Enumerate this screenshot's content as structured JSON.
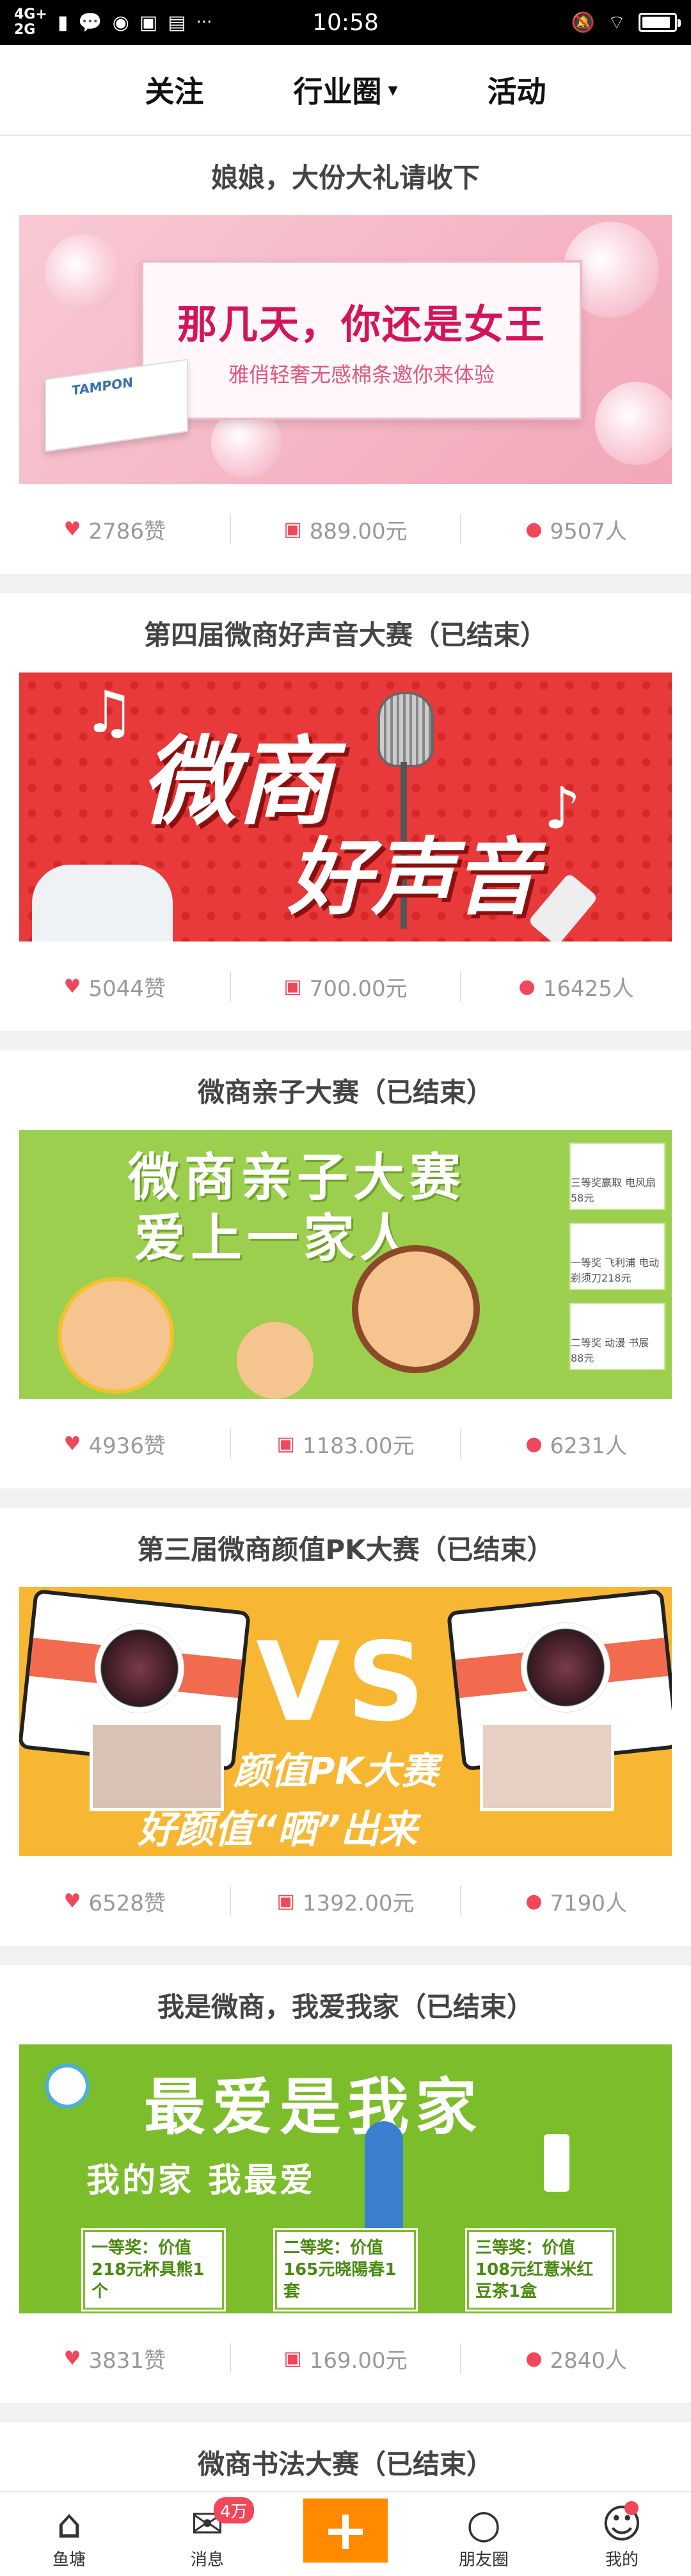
{
  "status_bar": {
    "network_top": "4G+",
    "network_bottom": "2G",
    "time": "10:58",
    "more": "···",
    "battery_level": 0.9
  },
  "top_nav": {
    "tabs": [
      "关注",
      "行业圈",
      "活动"
    ],
    "dropdown_caret": "▾"
  },
  "cards": [
    {
      "title": "娘娘，大份大礼请收下",
      "banner": {
        "headline": "那几天，你还是女王",
        "sub": "雅俏轻奢无感棉条邀你来体验",
        "brand": "TAMPON"
      },
      "likes": "2786赞",
      "amount": "889.00元",
      "people": "9507人"
    },
    {
      "title": "第四届微商好声音大赛（已结束）",
      "banner": {
        "line1": "微商",
        "line2": "好声音"
      },
      "likes": "5044赞",
      "amount": "700.00元",
      "people": "16425人"
    },
    {
      "title": "微商亲子大赛（已结束）",
      "banner": {
        "line1": "微商亲子大赛",
        "line2": "爱上一家人",
        "prizes": [
          "三等奖赢取 电风扇58元",
          "一等奖 飞利浦 电动剃须刀218元",
          "二等奖 动漫 书展 88元"
        ]
      },
      "likes": "4936赞",
      "amount": "1183.00元",
      "people": "6231人"
    },
    {
      "title": "第三届微商颜值PK大赛（已结束）",
      "banner": {
        "vs": "VS",
        "line1": "颜值PK大赛",
        "line2": "好颜值“晒”出来"
      },
      "likes": "6528赞",
      "amount": "1392.00元",
      "people": "7190人"
    },
    {
      "title": "我是微商，我爱我家（已结束）",
      "banner": {
        "line1": "最爱是我家",
        "line2": "我的家  我最爱",
        "prize1": "一等奖：价值 218元杯具熊1个",
        "prize2": "二等奖：价值 165元晓陽春1套",
        "prize3": "三等奖：价值 108元红薏米红 豆茶1盒"
      },
      "likes": "3831赞",
      "amount": "169.00元",
      "people": "2840人"
    },
    {
      "title": "微商书法大赛（已结束）"
    }
  ],
  "tab_bar": {
    "items": [
      "鱼塘",
      "消息",
      "",
      "朋友圈",
      "我的"
    ],
    "message_badge": "4万",
    "plus": "+"
  },
  "colors": {
    "accent": "#f0475a",
    "plus_button": "#ff8a00"
  }
}
